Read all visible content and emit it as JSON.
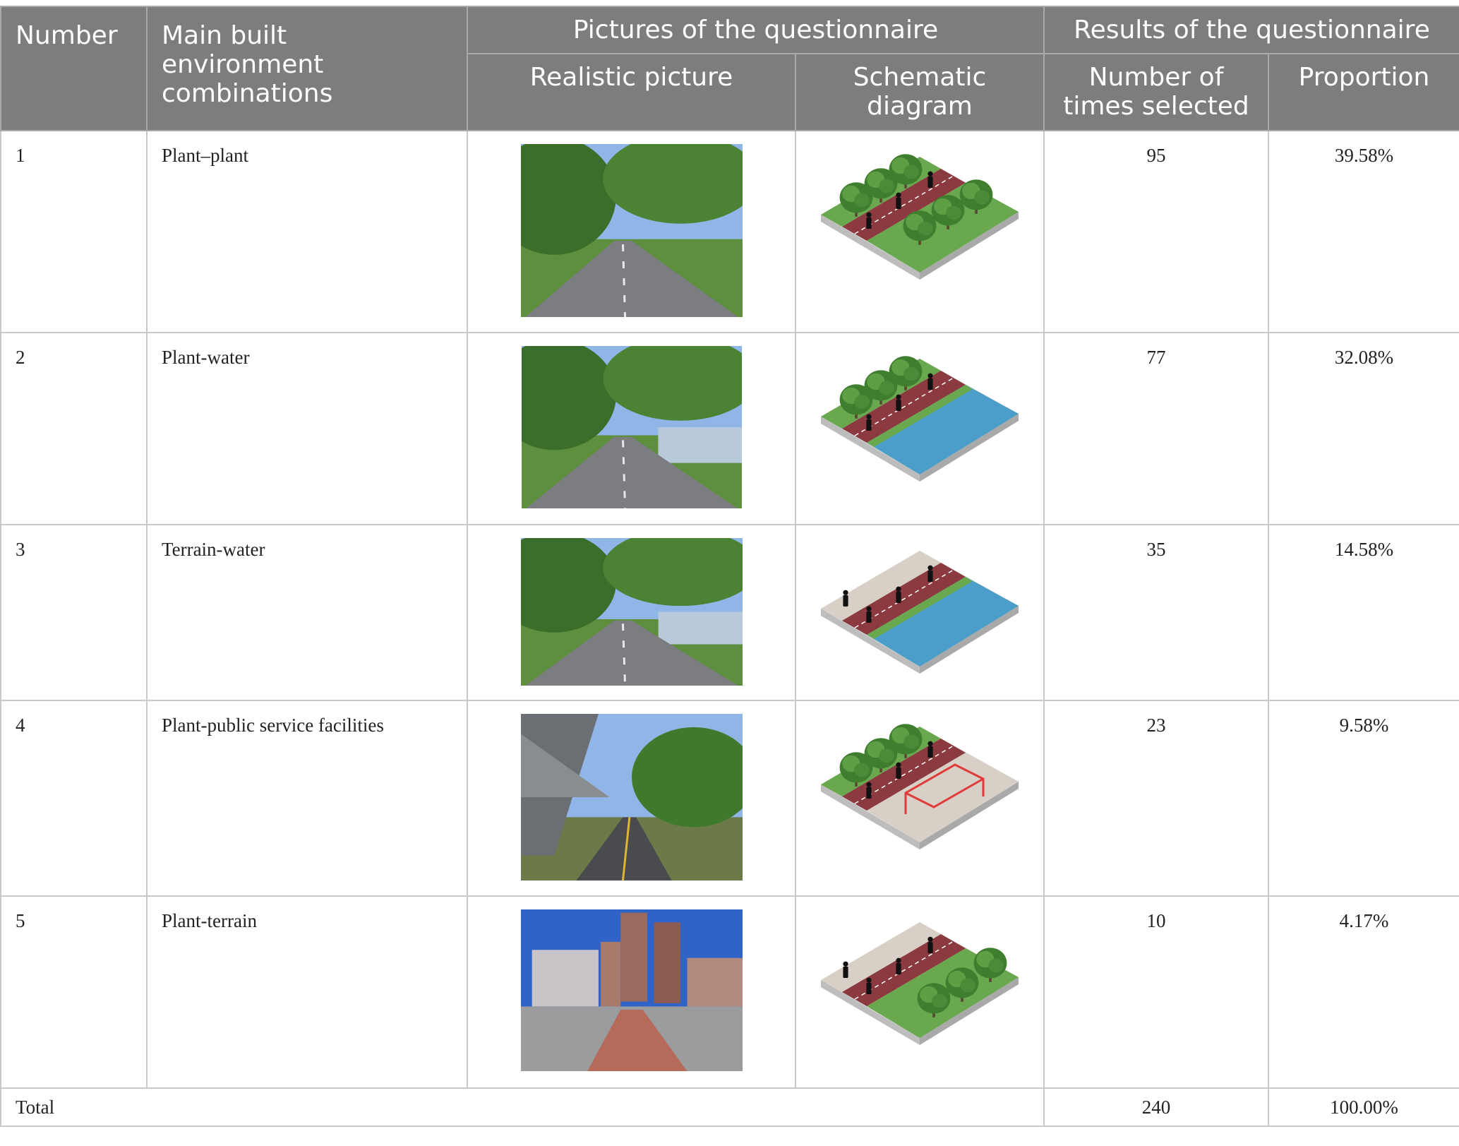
{
  "header": {
    "number": "Number",
    "combination": "Main built environment combinations",
    "pictures_group": "Pictures of the questionnaire",
    "realistic": "Realistic picture",
    "schematic": "Schematic diagram",
    "results_group": "Results of the questionnaire",
    "times_selected": "Number of times selected",
    "proportion": "Proportion"
  },
  "rows": [
    {
      "number": "1",
      "combination": "Plant–plant",
      "times": "95",
      "proportion": "39.58%",
      "scene": "plant-plant",
      "schematic_type": "plant-plant"
    },
    {
      "number": "2",
      "combination": "Plant-water",
      "times": "77",
      "proportion": "32.08%",
      "scene": "plant-water",
      "schematic_type": "plant-water"
    },
    {
      "number": "3",
      "combination": "Terrain-water",
      "times": "35",
      "proportion": "14.58%",
      "scene": "terrain-water",
      "schematic_type": "terrain-water"
    },
    {
      "number": "4",
      "combination": "Plant-public service facilities",
      "times": "23",
      "proportion": "9.58%",
      "scene": "plant-facilities",
      "schematic_type": "plant-facilities"
    },
    {
      "number": "5",
      "combination": "Plant-terrain",
      "times": "10",
      "proportion": "4.17%",
      "scene": "plant-terrain",
      "schematic_type": "plant-terrain"
    }
  ],
  "total": {
    "label": "Total",
    "times": "240",
    "proportion": "100.00%"
  },
  "colors": {
    "header_bg": "#7d7e7c",
    "grass": "#6aa84f",
    "bike_lane": "#8b3a3f",
    "water": "#4a9ec9",
    "paving": "#d8d0c6"
  }
}
